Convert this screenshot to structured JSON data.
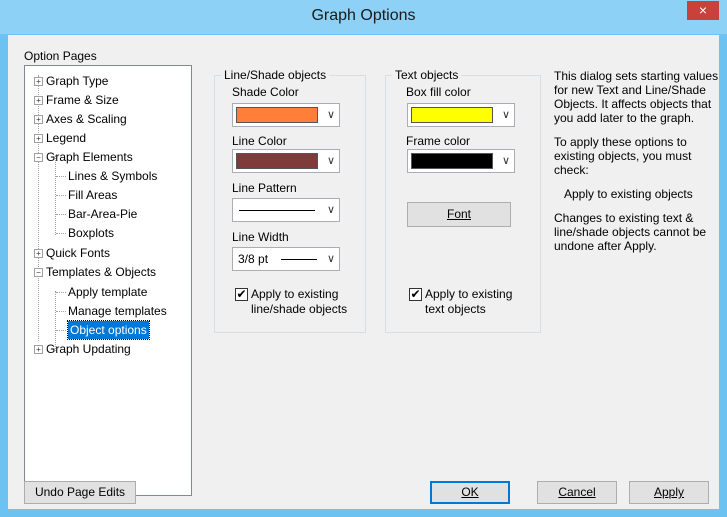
{
  "window": {
    "title": "Graph Options",
    "close_label": "×"
  },
  "option_pages": {
    "label": "Option Pages",
    "items": [
      {
        "label": "Graph Type",
        "expander": "+"
      },
      {
        "label": "Frame & Size",
        "expander": "+"
      },
      {
        "label": "Axes & Scaling",
        "expander": "+"
      },
      {
        "label": "Legend",
        "expander": "+"
      },
      {
        "label": "Graph Elements",
        "expander": "−"
      },
      {
        "label": "Lines & Symbols"
      },
      {
        "label": "Fill Areas"
      },
      {
        "label": "Bar-Area-Pie"
      },
      {
        "label": "Boxplots"
      },
      {
        "label": "Quick Fonts",
        "expander": "+"
      },
      {
        "label": "Templates & Objects",
        "expander": "−"
      },
      {
        "label": "Apply template"
      },
      {
        "label": "Manage templates"
      },
      {
        "label": "Object options"
      },
      {
        "label": "Graph Updating",
        "expander": "+"
      }
    ]
  },
  "line_shade": {
    "title": "Line/Shade objects",
    "shade_color_label": "Shade Color",
    "shade_color": "#ff7f3a",
    "line_color_label": "Line Color",
    "line_color": "#7f3a3a",
    "line_pattern_label": "Line Pattern",
    "line_width_label": "Line Width",
    "line_width_value": "3/8 pt",
    "apply_label_1": "Apply to existing",
    "apply_label_2": "line/shade objects"
  },
  "text_objects": {
    "title": "Text objects",
    "box_fill_label": "Box fill color",
    "box_fill_color": "#ffff00",
    "frame_color_label": "Frame color",
    "frame_color": "#000000",
    "font_button": "Font",
    "apply_label_1": "Apply to existing",
    "apply_label_2": "text objects"
  },
  "help": {
    "p1": "This dialog sets starting values for new Text and Line/Shade Objects.  It affects objects that you add later to the graph.",
    "p2": "To apply these options to existing objects, you must check:",
    "p3": "Apply to existing objects",
    "p4": "Changes to existing text & line/shade objects cannot be undone after Apply."
  },
  "buttons": {
    "undo": "Undo Page Edits",
    "ok": "OK",
    "cancel": "Cancel",
    "apply": "Apply"
  },
  "check_mark": "✔",
  "combo_arrow": "∨"
}
